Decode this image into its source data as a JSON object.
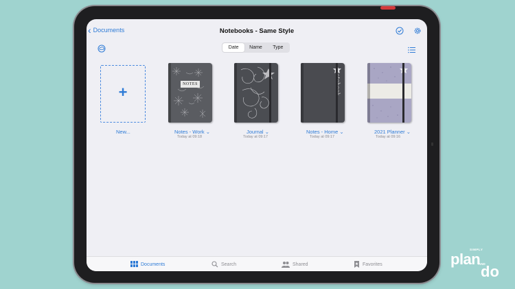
{
  "nav": {
    "back_label": "Documents",
    "title": "Notebooks - Same Style"
  },
  "sort": {
    "options": [
      "Date",
      "Name",
      "Type"
    ],
    "selected": "Date"
  },
  "new_item": {
    "label": "New..."
  },
  "notebooks": [
    {
      "name": "Notes - Work",
      "date": "Today at 09:18",
      "cover_text": "NOTES"
    },
    {
      "name": "Journal",
      "date": "Today at 09:17"
    },
    {
      "name": "Notes - Home",
      "date": "Today at 09:17",
      "cover_text": "notebook"
    },
    {
      "name": "2021 Planner",
      "date": "Today at 09:16"
    }
  ],
  "tabs": [
    {
      "label": "Documents",
      "icon": "grid-icon",
      "active": true
    },
    {
      "label": "Search",
      "icon": "search-icon"
    },
    {
      "label": "Shared",
      "icon": "people-icon"
    },
    {
      "label": "Favorites",
      "icon": "bookmark-icon"
    }
  ],
  "brand": {
    "small": "SIMPLY",
    "plan": "plan",
    "and": "AND",
    "do": "do"
  },
  "colors": {
    "accent": "#2e7bd6",
    "background": "#9fd3cf",
    "screen": "#efeff4"
  }
}
